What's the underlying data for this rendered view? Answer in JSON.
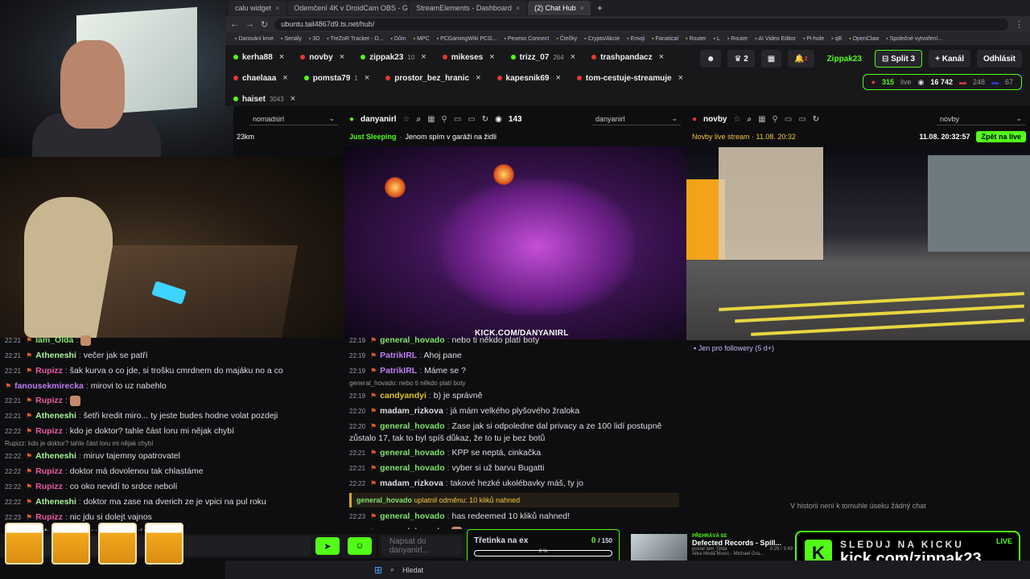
{
  "browser": {
    "tabs": [
      {
        "label": "calu widget",
        "active": false
      },
      {
        "label": "Odemčení 4K v DroidCam OBS - Go...",
        "active": false
      },
      {
        "label": "StreamElements - Dashboard",
        "active": false
      },
      {
        "label": "(2) Chat Hub",
        "active": true
      }
    ],
    "address": "ubuntu.tail4867d9.ts.net/hub/",
    "bookmarks": [
      "Darování krve",
      "Seriály",
      "3D",
      "TreZoR Tracker - D...",
      "Dům",
      "MPC",
      "PCGamingWiki PCG...",
      "Pexeso Connect",
      "Čtečky",
      "Crypto/Akcie",
      "Emoji",
      "Fanatical",
      "Router",
      "L",
      "Router",
      "AI Video Editor",
      "Pi-hole",
      "qB",
      "OpenClaw",
      "Společné vytvoření..."
    ]
  },
  "top": {
    "chips": [
      {
        "name": "kerha88",
        "dot": "green",
        "count": ""
      },
      {
        "name": "novby",
        "dot": "red",
        "count": ""
      },
      {
        "name": "zippak23",
        "dot": "green",
        "count": "10"
      },
      {
        "name": "mikeses",
        "dot": "red",
        "count": ""
      },
      {
        "name": "trizz_07",
        "dot": "green",
        "count": "264"
      },
      {
        "name": "trashpandacz",
        "dot": "red",
        "count": ""
      },
      {
        "name": "chaelaaa",
        "dot": "red",
        "count": ""
      },
      {
        "name": "pomsta79",
        "dot": "green",
        "count": "1"
      },
      {
        "name": "prostor_bez_hranic",
        "dot": "red",
        "count": ""
      },
      {
        "name": "kapesnik69",
        "dot": "red",
        "count": ""
      },
      {
        "name": "tom-cestuje-streamuje",
        "dot": "red",
        "count": ""
      },
      {
        "name": "haiset",
        "dot": "green",
        "count": "3043"
      }
    ],
    "crown_count": "2",
    "notif_count": "2",
    "user": "Zippak23",
    "split_label": "Split 3",
    "add_channel": "+ Kanál",
    "logout": "Odhlásit",
    "live": {
      "viewers": "315",
      "live_label": "live",
      "total": "16 742",
      "cz": "248",
      "sk": "67"
    }
  },
  "columns": {
    "left": {
      "select": "nomadsirl",
      "subtitle": "23km"
    },
    "mid": {
      "channel": "danyanirl",
      "viewers": "143",
      "select": "danyanirl",
      "category": "Just Sleeping",
      "title": "Jenom spím v garáži na židli",
      "overlay": "KICK.COM/DANYANIRL"
    },
    "right": {
      "channel": "novby",
      "select": "novby",
      "stream_label": "Novby live stream · 11.08. 20:32",
      "time": "11.08. 20:32:57",
      "back_live": "Zpět na live",
      "followers_only": "Jen pro followery (5 d+)",
      "empty": "V historii není k tomuhle úseku žádný chat"
    }
  },
  "colors": {
    "accent": "#53fc18",
    "bg": "#0e0e10"
  },
  "chat_left": [
    {
      "time": "22:21",
      "user": "Iam_Olda",
      "color": "#7fe26a",
      "text": ""
    },
    {
      "time": "22:21",
      "user": "Atheneshi",
      "color": "#a7f39b",
      "text": "večer jak se patří"
    },
    {
      "time": "22:21",
      "user": "Rupizz",
      "color": "#e55aa4",
      "text": "šak kurva o co jde, si trošku cmrdnem do majáku no a co"
    },
    {
      "time": "",
      "user": "fanousekmirecka",
      "color": "#c17df6",
      "text": "mirovi to uz nabehlo"
    },
    {
      "time": "22:21",
      "user": "Rupizz",
      "color": "#e55aa4",
      "text": ""
    },
    {
      "time": "22:21",
      "user": "Atheneshi",
      "color": "#a7f39b",
      "text": "šetři kredit miro... ty jeste budes hodne volat pozdeji"
    },
    {
      "time": "22:22",
      "user": "Rupizz",
      "color": "#e55aa4",
      "text": "kdo je doktor? tahle část loru mi nějak chybí"
    },
    {
      "reply": "Rupizz: kdo je doktor? tahle část loru mi nějak chybí"
    },
    {
      "time": "22:22",
      "user": "Atheneshi",
      "color": "#a7f39b",
      "text": "miruv tajemny opatrovatel"
    },
    {
      "time": "22:22",
      "user": "Rupizz",
      "color": "#e55aa4",
      "text": "doktor má dovolenou tak chlastáme"
    },
    {
      "time": "22:22",
      "user": "Rupizz",
      "color": "#e55aa4",
      "text": "co oko nevidí to srdce nebolí"
    },
    {
      "time": "22:22",
      "user": "Atheneshi",
      "color": "#a7f39b",
      "text": "doktor ma zase na dverich ze je vpici na pul roku"
    },
    {
      "time": "22:23",
      "user": "Rupizz",
      "color": "#e55aa4",
      "text": "nic jdu si dolejt vajnos"
    },
    {
      "time": "22:23",
      "user": "Atheneshi",
      "color": "#a7f39b",
      "text": "stará mu hulí kára"
    }
  ],
  "chat_mid": [
    {
      "time": "22:19",
      "user": "general_hovado",
      "color": "#7fe26a",
      "text": "nebo ti někdo platí boty"
    },
    {
      "time": "22:19",
      "user": "PatrikIRL",
      "color": "#c17df6",
      "text": "Ahoj pane"
    },
    {
      "time": "22:19",
      "user": "PatrikIRL",
      "color": "#c17df6",
      "text": "Máme se ?"
    },
    {
      "reply": "general_hovado: nebo ti někdo platí boty"
    },
    {
      "time": "22:19",
      "user": "candyandyi",
      "color": "#e0c41a",
      "text": "b) je správně"
    },
    {
      "time": "22:20",
      "user": "madam_rizkova",
      "color": "#dedee3",
      "text": "já mám velkého plyšového žraloka"
    },
    {
      "time": "22:20",
      "user": "general_hovado",
      "color": "#7fe26a",
      "text": "Zase jak si odpoledne dal privacy a ze 100 lidí postupně zůstalo 17, tak to byl spíš důkaz, že to tu je bez botů",
      "wrap": true
    },
    {
      "time": "22:21",
      "user": "general_hovado",
      "color": "#7fe26a",
      "text": "KPP se neptá, cinkačka"
    },
    {
      "time": "22:21",
      "user": "general_hovado",
      "color": "#7fe26a",
      "text": "vyber si už barvu Bugatti"
    },
    {
      "time": "22:22",
      "user": "madam_rizkova",
      "color": "#dedee3",
      "text": "takové hezké ukolébavky máš, ty jo"
    },
    {
      "redeem": true,
      "user": "general_hovado",
      "text": "uplatnil odměnu: 10 kliků nahned"
    },
    {
      "time": "22:23",
      "user": "general_hovado",
      "color": "#7fe26a",
      "text": "has redeemed 10 kliků nahned!"
    },
    {
      "time": "22:23",
      "user": "general_hovado",
      "color": "#7fe26a",
      "text": ""
    }
  ],
  "input": {
    "mid_placeholder": "Napsat do danyanirl..."
  },
  "goal": {
    "label": "Třetinka na ex",
    "current": "0",
    "target": "/ 150",
    "percent_label": "0 %",
    "fraction": 0
  },
  "music": {
    "heading": "PŘEHRÁVÁ SE",
    "title": "Defected Records - Spill...",
    "posted": "posial Iam_Olda",
    "time": "0:29 / 3:49",
    "artist": "Altra Moda Music - Michael Gra..."
  },
  "banner": {
    "top": "SLEDUJ NA KICKU",
    "url": "kick.com/zippak23",
    "live": "LIVE",
    "logo": "K"
  },
  "taskbar": {
    "search": "Hledat"
  }
}
